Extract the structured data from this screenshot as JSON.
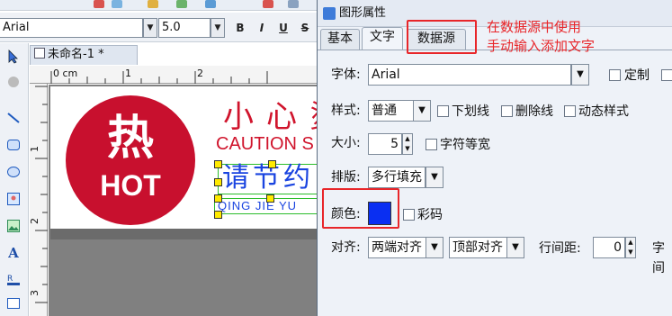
{
  "font_toolbar": {
    "font_name": "Arial",
    "font_size": "5.0",
    "bold": "B",
    "italic": "I",
    "underline": "U",
    "strike": "S"
  },
  "document": {
    "tab_title": "未命名-1 *",
    "ruler_unit": "0 cm",
    "ruler_marks": [
      "1",
      "2"
    ],
    "vruler_marks": [
      "1",
      "2",
      "3"
    ]
  },
  "label": {
    "hot_text": "热",
    "hot_sub": "HOT",
    "warn_cn": "小心烫",
    "warn_en": "CAUTION S",
    "blue_cn": "请节约",
    "blue_pinyin": "QING JIE YU"
  },
  "dialog": {
    "title": "图形属性",
    "tabs": [
      "基本",
      "文字",
      "数据源"
    ],
    "font_label": "字体:",
    "font_value": "Arial",
    "custom_check": "定制",
    "style_label": "样式:",
    "style_value": "普通",
    "underline": "下划线",
    "strikeout": "删除线",
    "dynamic": "动态样式",
    "size_label": "大小:",
    "size_value": "5",
    "mono": "字符等宽",
    "layout_label": "排版:",
    "layout_value": "多行填充",
    "color_label": "颜色:",
    "color_value": "#0a2ff2",
    "rainbow": "彩码",
    "align_label": "对齐:",
    "align_h": "两端对齐",
    "align_v": "顶部对齐",
    "linespace_label": "行间距:",
    "linespace_value": "0",
    "charspace_label": "字间"
  },
  "annotation": {
    "line1": "在数据源中使用",
    "line2": "手动输入添加文字"
  },
  "colors": {
    "accent_red": "#e8262a",
    "hot_red": "#c8102e",
    "blue_text": "#1a44e0"
  }
}
